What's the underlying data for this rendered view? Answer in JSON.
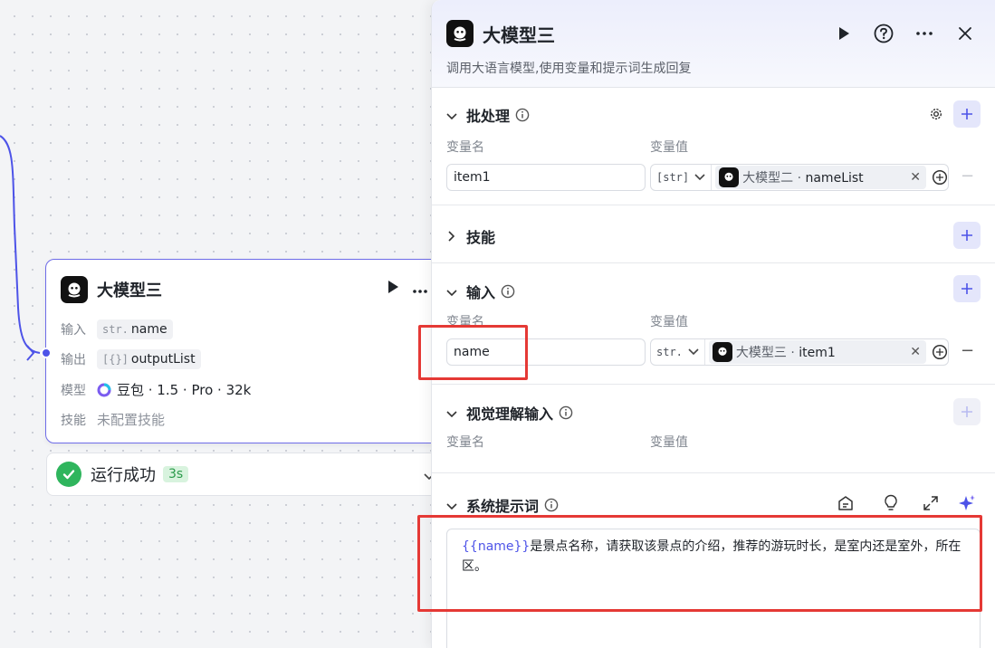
{
  "canvas_node": {
    "title": "大模型三",
    "rows": {
      "input": {
        "label": "输入",
        "type_prefix": "str.",
        "value": "name"
      },
      "output": {
        "label": "输出",
        "type_prefix": "[{}]",
        "value": "outputList"
      },
      "model": {
        "label": "模型",
        "value": "豆包 · 1.5 · Pro · 32k"
      },
      "skills": {
        "label": "技能",
        "value": "未配置技能"
      }
    },
    "status": {
      "text": "运行成功",
      "time": "3s"
    }
  },
  "panel": {
    "title": "大模型三",
    "description": "调用大语言模型,使用变量和提示词生成回复",
    "batch": {
      "title": "批处理",
      "col_name": "变量名",
      "col_value": "变量值",
      "row": {
        "name": "item1",
        "type_code": "[str]",
        "ref_node": "大模型二",
        "ref_var": "nameList"
      }
    },
    "skills": {
      "title": "技能"
    },
    "inputs": {
      "title": "输入",
      "col_name": "变量名",
      "col_value": "变量值",
      "row": {
        "name": "name",
        "type_code": "str.",
        "ref_node": "大模型三",
        "ref_var": "item1"
      }
    },
    "vision": {
      "title": "视觉理解输入",
      "col_name": "变量名",
      "col_value": "变量值"
    },
    "system_prompt": {
      "title": "系统提示词",
      "variable": "{{name}}",
      "text": "是景点名称，请获取该景点的介绍，推荐的游玩时长，是室内还是室外，所在区。"
    },
    "separator": " · "
  },
  "colors": {
    "accent": "#4d53e8",
    "success": "#2fb55d",
    "highlight": "#e53935"
  },
  "icons": {
    "app": "robot-face-icon",
    "run": "play-icon",
    "help": "question-circle-icon",
    "more": "more-horizontal-icon",
    "close": "close-icon"
  }
}
